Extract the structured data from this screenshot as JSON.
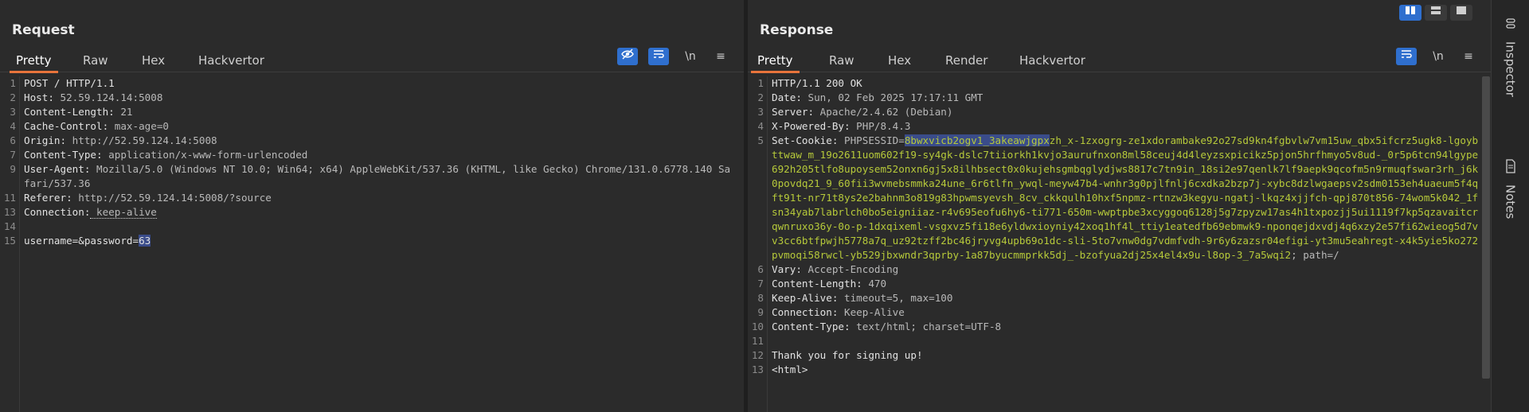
{
  "request": {
    "title": "Request",
    "tabs": [
      "Pretty",
      "Raw",
      "Hex",
      "Hackvertor"
    ],
    "tools": {
      "newline_label": "\\n",
      "menu_label": "≡"
    },
    "lines": [
      {
        "n": "1",
        "text": "POST / HTTP/1.1"
      },
      {
        "n": "2",
        "key": "Host:",
        "val": " 52.59.124.14:5008"
      },
      {
        "n": "3",
        "key": "Content-Length:",
        "val": " 21"
      },
      {
        "n": "4",
        "key": "Cache-Control:",
        "val": " max-age=0"
      },
      {
        "n": "6",
        "key": "Origin:",
        "val": " http://52.59.124.14:5008"
      },
      {
        "n": "7",
        "key": "Content-Type:",
        "val": " application/x-www-form-urlencoded"
      },
      {
        "n": "9",
        "key": "User-Agent:",
        "val": " Mozilla/5.0 (Windows NT 10.0; Win64; x64) AppleWebKit/537.36 (KHTML, like Gecko) Chrome/131.0.6778.140 Safari/537.36"
      },
      {
        "n": "11",
        "key": "Referer:",
        "val": " http://52.59.124.14:5008/?source"
      },
      {
        "n": "13",
        "key": "Connection:",
        "val": " keep-alive"
      },
      {
        "n": "14",
        "text": ""
      },
      {
        "n": "15",
        "body_prefix": "username=&password=",
        "body_sel": "63"
      }
    ]
  },
  "response": {
    "title": "Response",
    "tabs": [
      "Pretty",
      "Raw",
      "Hex",
      "Render",
      "Hackvertor"
    ],
    "tools": {
      "newline_label": "\\n",
      "menu_label": "≡"
    },
    "lines": [
      {
        "n": "1",
        "text": "HTTP/1.1 200 OK"
      },
      {
        "n": "2",
        "key": "Date:",
        "val": " Sun, 02 Feb 2025 17:17:11 GMT"
      },
      {
        "n": "3",
        "key": "Server:",
        "val": " Apache/2.4.62 (Debian)"
      },
      {
        "n": "4",
        "key": "X-Powered-By:",
        "val": " PHP/8.4.3"
      },
      {
        "n": "5",
        "key": "Set-Cookie:",
        "val": " PHPSESSID=",
        "cookie_sel": "8bwxvicb2ogv1_3akeawjgpx",
        "cookie_rest": "zh_x-1zxogrg-ze1xdorambake92o27sd9kn4fgbvlw7vm15uw_qbx5ifcrz5ugk8-lgoybttwaw_m_19o2611uom602f19-sy4gk-dslc7tiiorkh1kvjo3aurufnxon8ml58ceuj4d4leyzsxpicikz5pjon5hrfhmyo5v8ud-_0r5p6tcn94lgype692h205tlfo8upoysem52onxn6gj5x8ilhbsect0x0kujehsgmbqglydjws8817c7tn9in_18si2e97qenlk7lf9aepk9qcofm5n9rmuqfswar3rh_j6k0povdq21_9_60fii3wvmebsmmka24une_6r6tlfn_ywql-meyw47b4-wnhr3g0pjlfnlj6cxdka2bzp7j-xybc8dzlwgaepsv2sdm0153eh4uaeum5f4qft91t-nr71t8ys2e2bahnm3o819g83hpwmsyevsh_8cv_ckkqulh10hxf5npmz-rtnzw3kegyu-ngatj-lkqz4xjjfch-qpj870t856-74wom5k042_1fsn34yab7labrlch0bo5eigniiaz-r4v695eofu6hy6-ti771-650m-wwptpbe3xcyggoq6128j5g7zpyzw17as4h1txpozjj5ui1119f7kp5qzavaitcrqwnruxo36y-0o-p-1dxqixeml-vsgxvz5fi18e6yldwxioyniy42xoq1hf4l_ttiy1eatedfb69ebmwk9-nponqejdxvdj4q6xzy2e57fi62wieog5d7vv3cc6btfpwjh5778a7q_uz92tzff2bc46jryvg4upb69o1dc-sli-5to7vnw0dg7vdmfvdh-9r6y6zazsr04efigi-yt3mu5eahregt-x4k5yie5ko272pvmoqi58rwcl-yb529jbxwndr3qprby-1a87byucmmprkk5dj_-bzofyua2dj25x4el4x9u-l8op-3_7a5wqi2",
        "cookie_tail": "; path=/"
      },
      {
        "n": "6",
        "key": "Vary:",
        "val": " Accept-Encoding"
      },
      {
        "n": "7",
        "key": "Content-Length:",
        "val": " 470"
      },
      {
        "n": "8",
        "key": "Keep-Alive:",
        "val": " timeout=5, max=100"
      },
      {
        "n": "9",
        "key": "Connection:",
        "val": " Keep-Alive"
      },
      {
        "n": "10",
        "key": "Content-Type:",
        "val": " text/html; charset=UTF-8"
      },
      {
        "n": "11",
        "text": ""
      },
      {
        "n": "12",
        "text": "Thank you for signing up!"
      },
      {
        "n": "13",
        "text": "<html>"
      }
    ]
  },
  "sidebar": {
    "inspector_label": "Inspector",
    "notes_label": "Notes"
  },
  "colors": {
    "accent_tab": "#e8743b",
    "active_tool": "#2f6fce",
    "cookie_value": "#b6c93a"
  }
}
